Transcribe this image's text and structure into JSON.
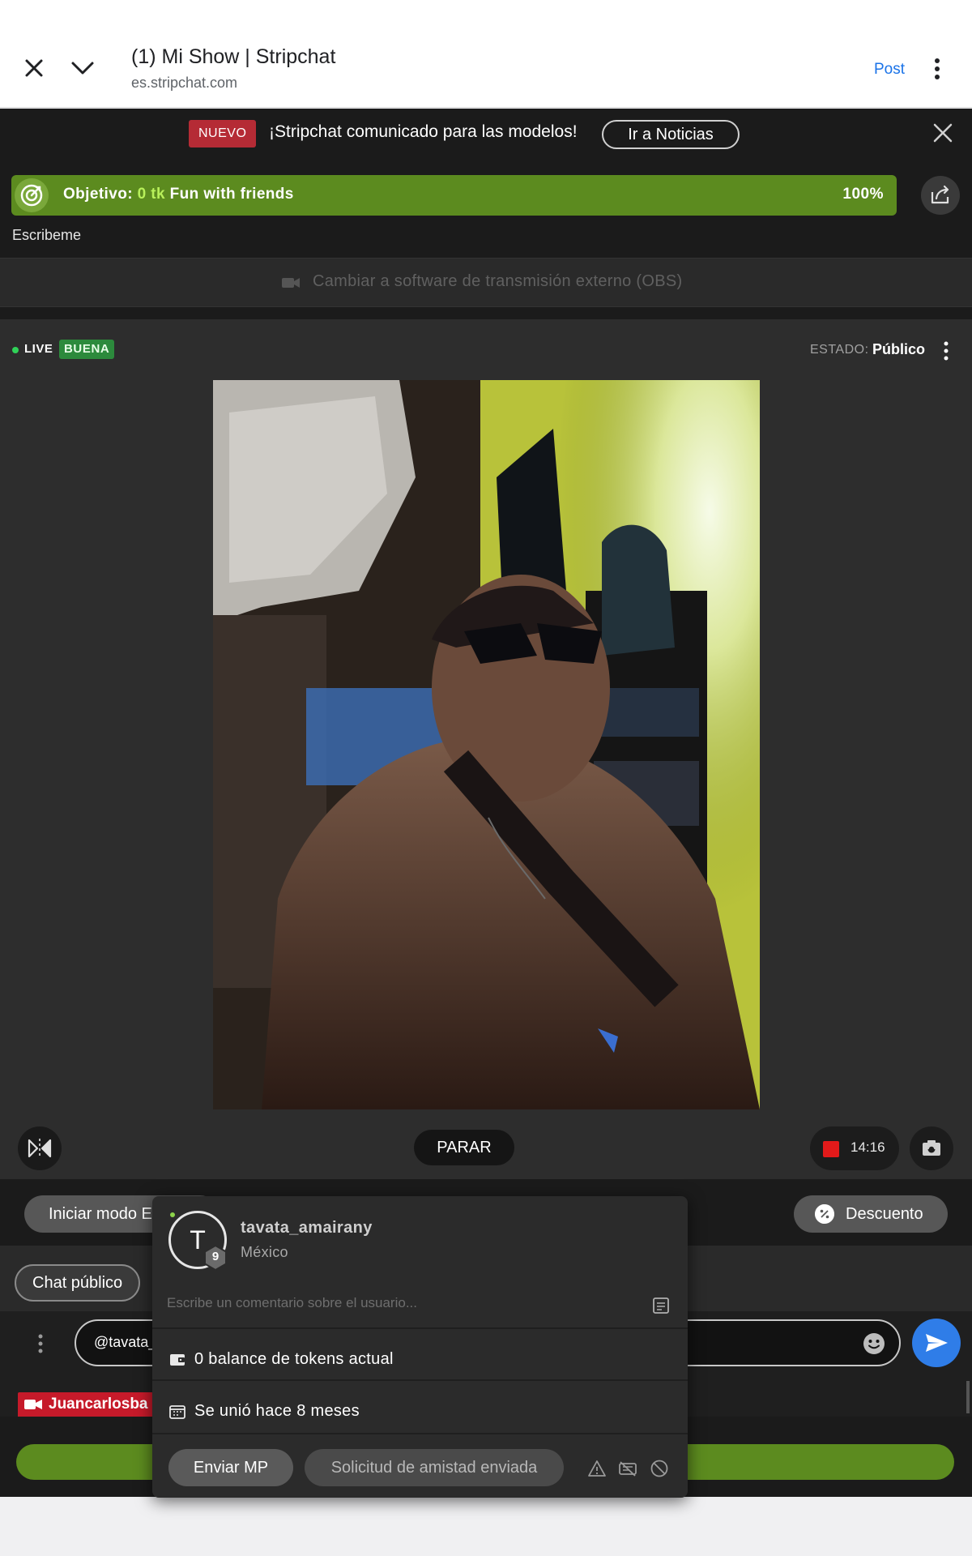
{
  "browser": {
    "title": "(1) Mi Show | Stripchat",
    "url": "es.stripchat.com",
    "post_label": "Post"
  },
  "news": {
    "badge": "NUEVO",
    "text": "¡Stripchat comunicado para las modelos!",
    "button": "Ir a Noticias"
  },
  "goal": {
    "label": "Objetivo:",
    "tokens": "0 tk",
    "name": "Fun with friends",
    "percent": "100%",
    "progress": 1.0,
    "description": "Escribeme"
  },
  "obs": {
    "text": "Cambiar a software de transmisión externo (OBS)"
  },
  "stream": {
    "live": "LIVE",
    "quality": "BUENA",
    "estado_label": "ESTADO:",
    "estado_value": "Público",
    "stop_label": "PARAR",
    "record_time": "14:16"
  },
  "actions": {
    "start_mode": "Iniciar modo E",
    "discount": "Descuento"
  },
  "chat": {
    "tab": "Chat público",
    "input_value": "@tavata_",
    "message_user": "Juancarlosba"
  },
  "popup": {
    "avatar_letter": "T",
    "level": "9",
    "username": "tavata_amairany",
    "country": "México",
    "comment_placeholder": "Escribe un comentario sobre el usuario...",
    "balance": "0 balance de tokens actual",
    "joined": "Se unió hace 8 meses",
    "pm_button": "Enviar MP",
    "friend_button": "Solicitud de amistad enviada"
  },
  "colors": {
    "goal_green": "#5c8b1f",
    "accent_blue": "#2f7de8",
    "badge_red": "#b52b35",
    "live_green": "#30d158"
  },
  "icons": [
    "close-icon",
    "chevron-down-icon",
    "more-vertical-icon",
    "target-icon",
    "share-icon",
    "video-camera-icon",
    "mirror-icon",
    "record-icon",
    "camera-switch-icon",
    "percent-icon",
    "emoji-icon",
    "send-icon",
    "wallet-icon",
    "calendar-icon",
    "note-icon",
    "warning-icon",
    "no-video-icon",
    "block-icon"
  ]
}
